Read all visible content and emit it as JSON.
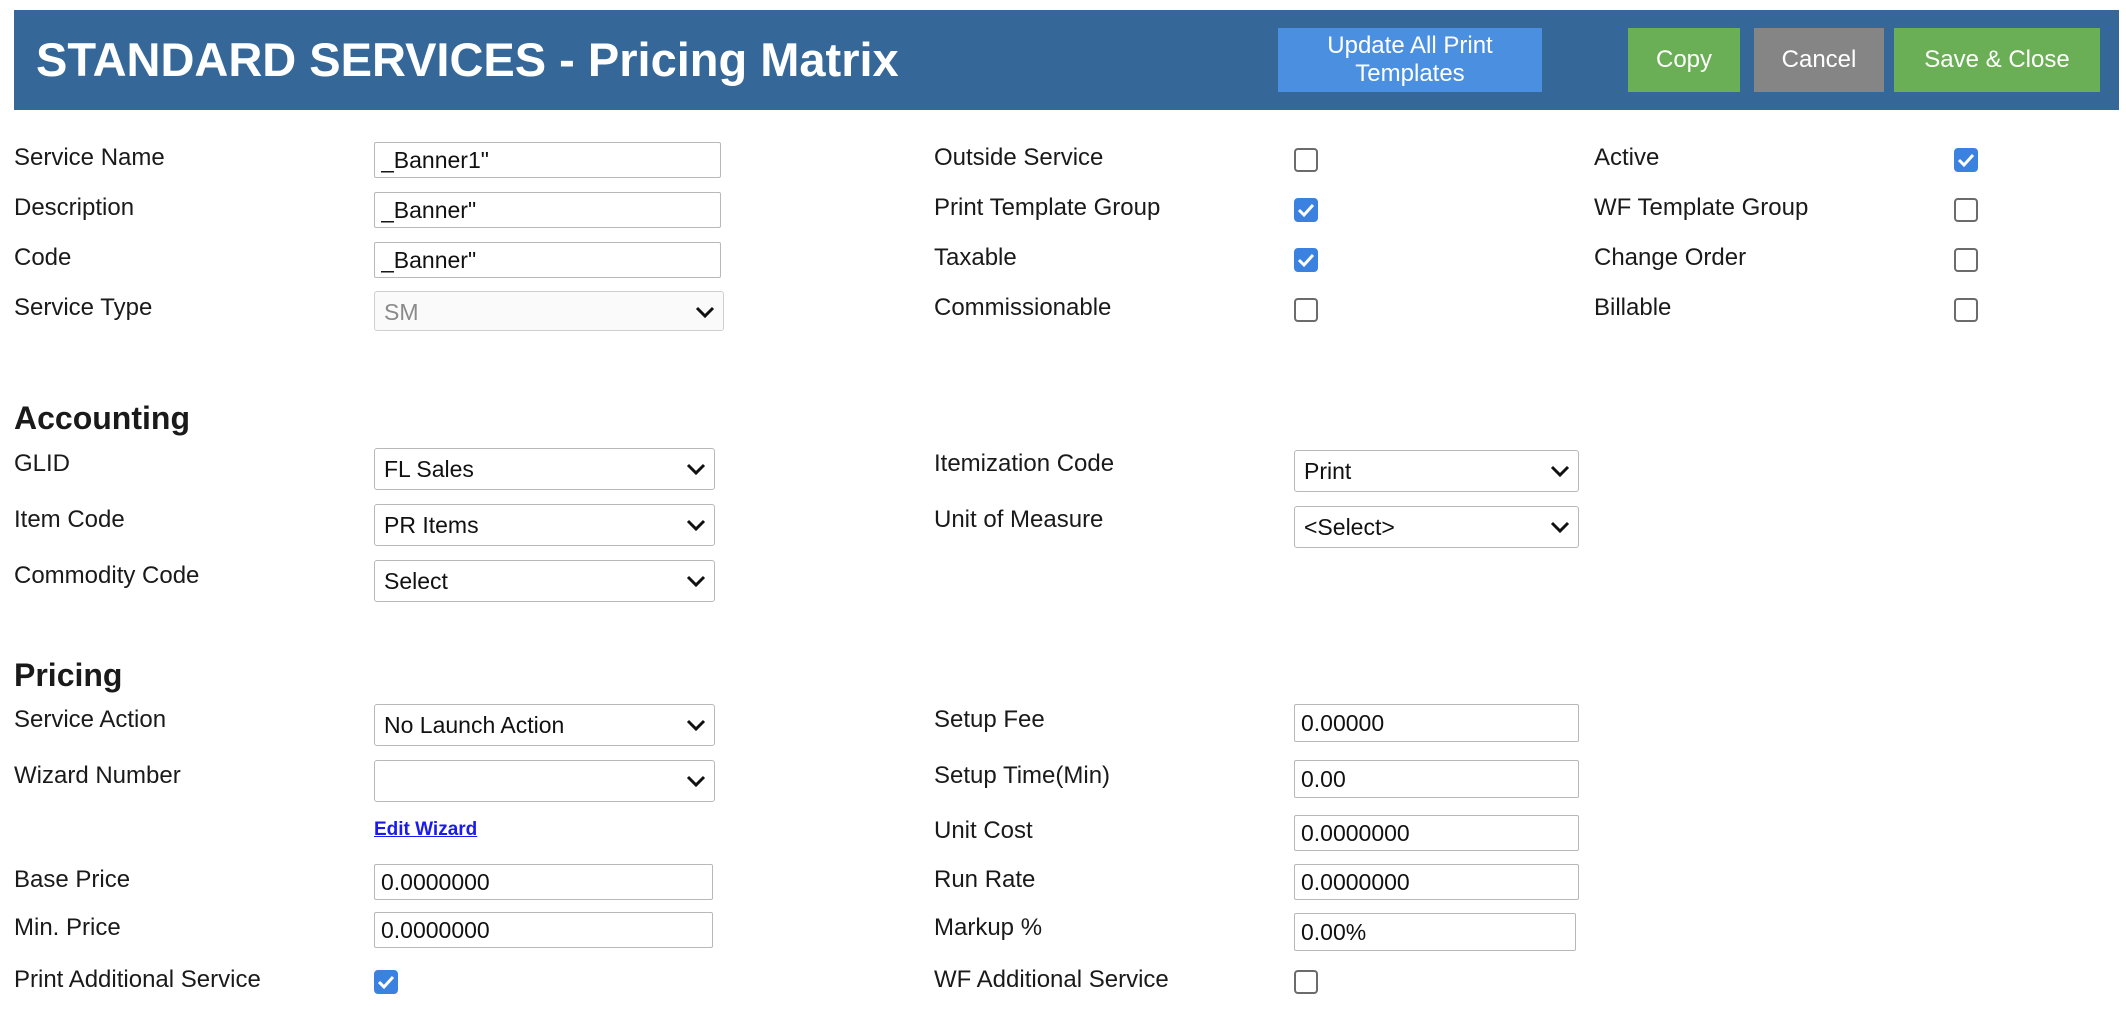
{
  "header": {
    "title": "STANDARD SERVICES - Pricing Matrix",
    "buttons": {
      "update_templates": "Update All Print Templates",
      "copy": "Copy",
      "cancel": "Cancel",
      "save_close": "Save & Close"
    },
    "colors": {
      "bar": "#356899",
      "update_templates": "#4b90e0",
      "copy": "#6aae55",
      "cancel": "#858585",
      "save_close": "#6aae55"
    }
  },
  "general": {
    "service_name": {
      "label": "Service Name",
      "value": "_Banner1\""
    },
    "description": {
      "label": "Description",
      "value": "_Banner\""
    },
    "code": {
      "label": "Code",
      "value": "_Banner\""
    },
    "service_type": {
      "label": "Service Type",
      "value": "SM"
    },
    "outside_service": {
      "label": "Outside Service",
      "checked": false
    },
    "print_template_group": {
      "label": "Print Template Group",
      "checked": true
    },
    "taxable": {
      "label": "Taxable",
      "checked": true
    },
    "commissionable": {
      "label": "Commissionable",
      "checked": false
    },
    "active": {
      "label": "Active",
      "checked": true
    },
    "wf_template_group": {
      "label": "WF Template Group",
      "checked": false
    },
    "change_order": {
      "label": "Change Order",
      "checked": false
    },
    "billable": {
      "label": "Billable",
      "checked": false
    }
  },
  "accounting": {
    "heading": "Accounting",
    "glid": {
      "label": "GLID",
      "value": "FL Sales"
    },
    "item_code": {
      "label": "Item Code",
      "value": "PR Items"
    },
    "commodity_code": {
      "label": "Commodity Code",
      "value": "Select"
    },
    "itemization_code": {
      "label": "Itemization Code",
      "value": "Print"
    },
    "unit_of_measure": {
      "label": "Unit of Measure",
      "value": "<Select>"
    }
  },
  "pricing": {
    "heading": "Pricing",
    "service_action": {
      "label": "Service Action",
      "value": "No Launch Action"
    },
    "wizard_number": {
      "label": "Wizard Number",
      "value": ""
    },
    "edit_wizard": "Edit Wizard",
    "base_price": {
      "label": "Base Price",
      "value": "0.0000000"
    },
    "min_price": {
      "label": "Min. Price",
      "value": "0.0000000"
    },
    "print_additional_service": {
      "label": "Print Additional Service",
      "checked": true
    },
    "setup_fee": {
      "label": "Setup Fee",
      "value": "0.00000"
    },
    "setup_time": {
      "label": "Setup Time(Min)",
      "value": "0.00"
    },
    "unit_cost": {
      "label": "Unit Cost",
      "value": "0.0000000"
    },
    "run_rate": {
      "label": "Run Rate",
      "value": "0.0000000"
    },
    "markup": {
      "label": "Markup %",
      "value": "0.00%"
    },
    "wf_additional_service": {
      "label": "WF Additional Service",
      "checked": false
    }
  }
}
